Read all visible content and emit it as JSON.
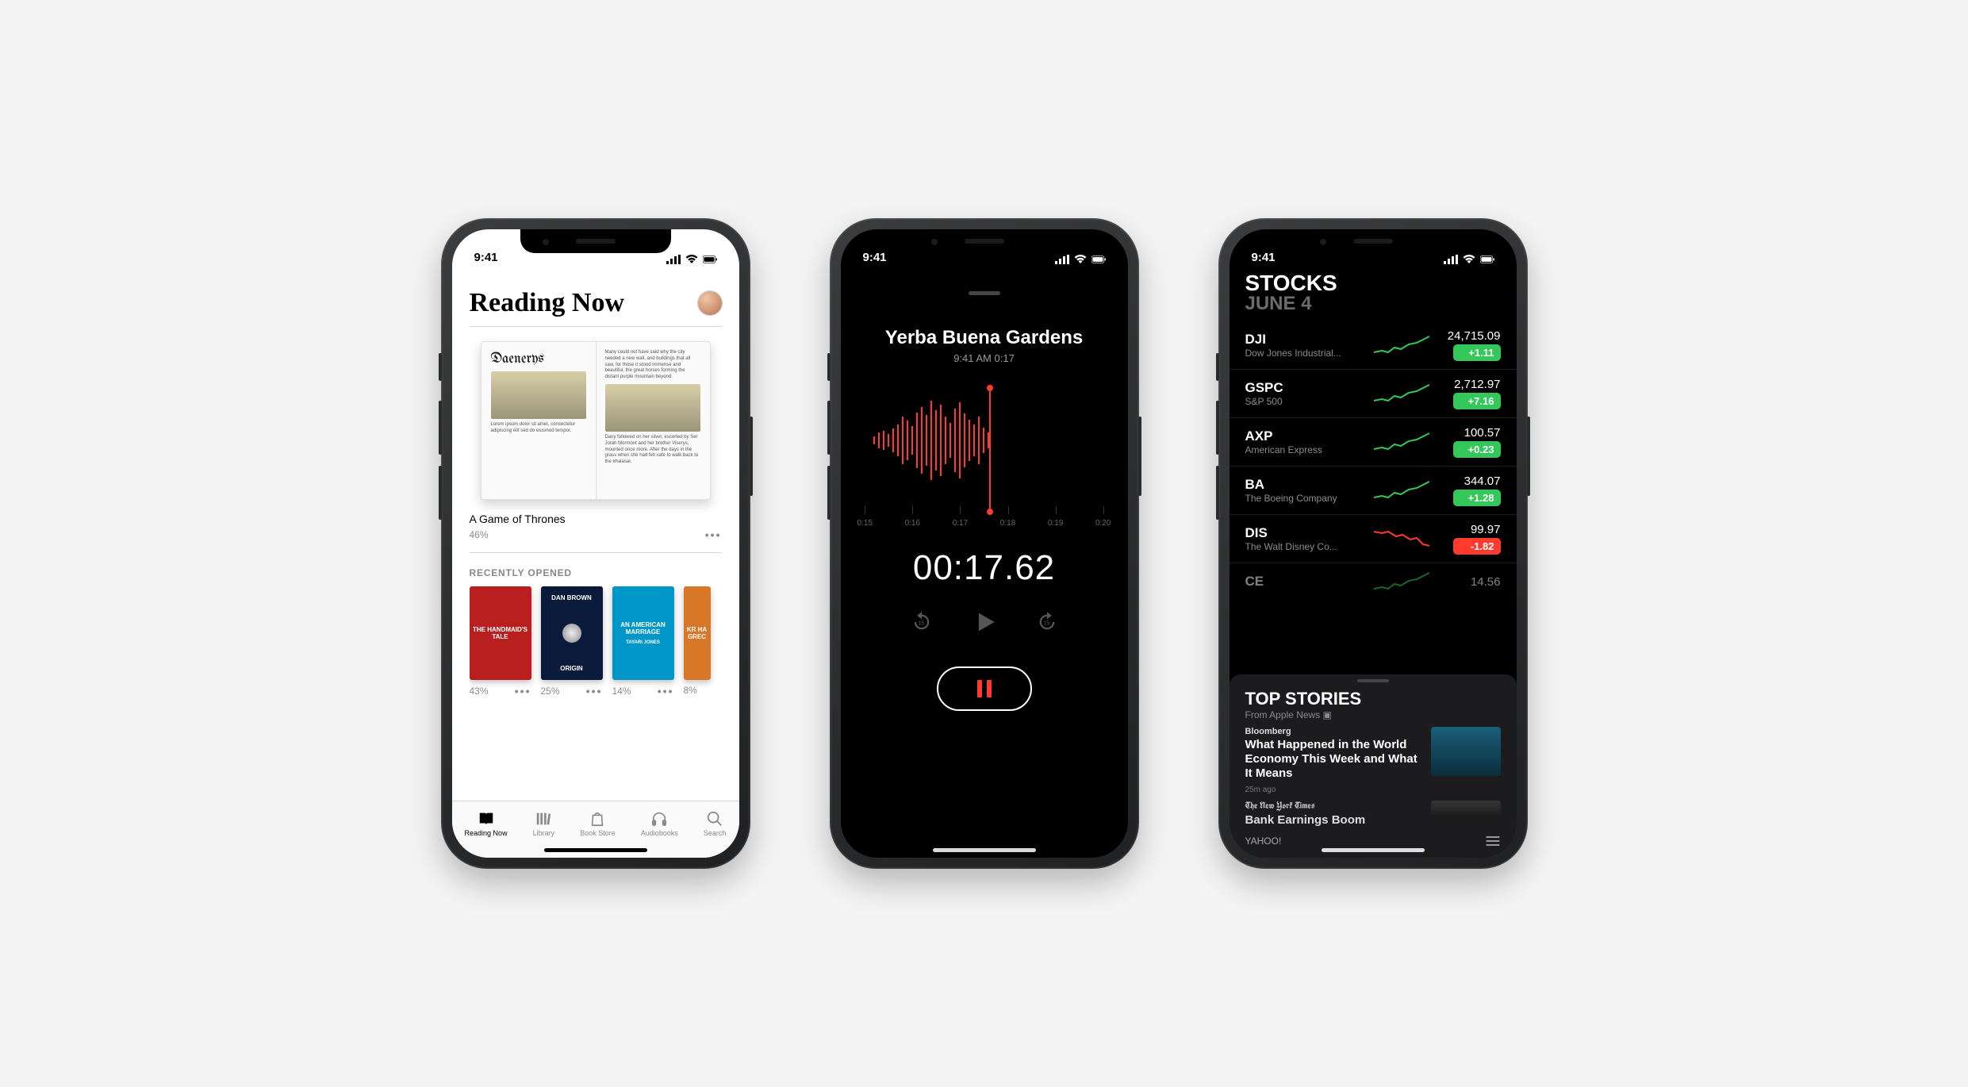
{
  "status": {
    "time": "9:41"
  },
  "books": {
    "title": "Reading Now",
    "hr": "—",
    "current": {
      "chapter_heading": "Daenerys",
      "title": "A Game of Thrones",
      "progress": "46%"
    },
    "recently_label": "RECENTLY OPENED",
    "recent": [
      {
        "cover_title": "THE HANDMAID'S TALE",
        "cover_author": "",
        "progress": "43%",
        "bg": "#b91f1f"
      },
      {
        "cover_title": "ORIGIN",
        "cover_author": "DAN BROWN",
        "progress": "25%",
        "bg": "#0a1a3a"
      },
      {
        "cover_title": "AN AMERICAN MARRIAGE",
        "cover_author": "TAYARI JONES",
        "progress": "14%",
        "bg": "#0096c7"
      },
      {
        "cover_title": "KR HA GREC",
        "cover_author": "",
        "progress": "8%",
        "bg": "#d97728"
      }
    ],
    "tabs": {
      "reading_now": "Reading Now",
      "library": "Library",
      "book_store": "Book Store",
      "audiobooks": "Audiobooks",
      "search": "Search"
    }
  },
  "voice": {
    "title": "Yerba Buena Gardens",
    "subtitle": "9:41 AM   0:17",
    "timer": "00:17.62",
    "ticks": [
      "0:15",
      "0:16",
      "0:17",
      "0:18",
      "0:19",
      "0:20"
    ]
  },
  "stocks": {
    "header": "STOCKS",
    "date": "JUNE 4",
    "rows": [
      {
        "sym": "DJI",
        "name": "Dow Jones Industrial...",
        "price": "24,715.09",
        "chg": "+1.11",
        "dir": "up"
      },
      {
        "sym": "GSPC",
        "name": "S&P 500",
        "price": "2,712.97",
        "chg": "+7.16",
        "dir": "up"
      },
      {
        "sym": "AXP",
        "name": "American Express",
        "price": "100.57",
        "chg": "+0.23",
        "dir": "up"
      },
      {
        "sym": "BA",
        "name": "The Boeing Company",
        "price": "344.07",
        "chg": "+1.28",
        "dir": "up"
      },
      {
        "sym": "DIS",
        "name": "The Walt Disney Co...",
        "price": "99.97",
        "chg": "-1.82",
        "dir": "dn"
      },
      {
        "sym": "CE",
        "name": "",
        "price": "14.56",
        "chg": "",
        "dir": "up"
      }
    ],
    "news": {
      "header": "TOP STORIES",
      "sub": "From Apple News ▣",
      "stories": [
        {
          "publisher": "Bloomberg",
          "headline": "What Happened in the World Economy This Week and What It Means",
          "ago": "25m ago"
        },
        {
          "publisher": "The New York Times",
          "headline": "Bank Earnings Boom",
          "ago": ""
        }
      ],
      "provider": "YAHOO!"
    }
  }
}
